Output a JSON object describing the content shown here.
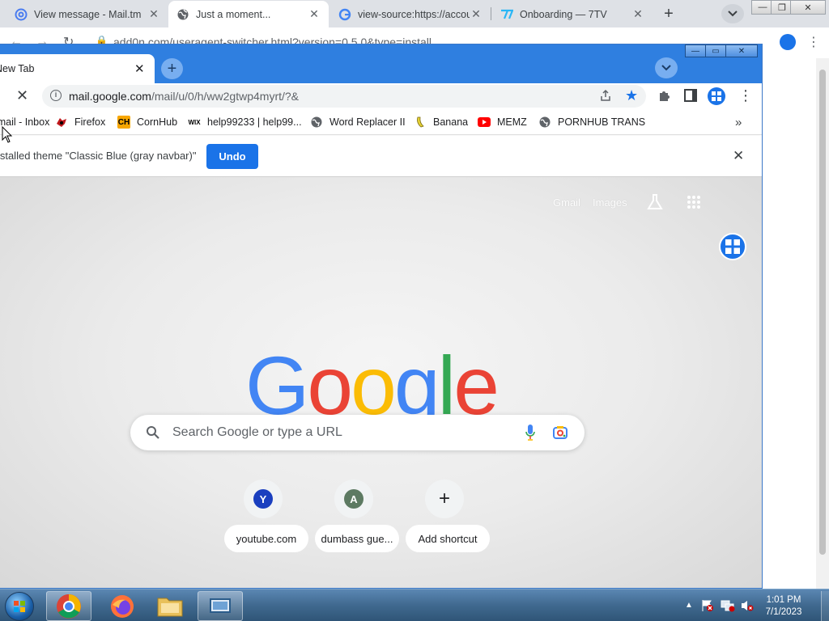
{
  "back_window": {
    "tabs": [
      {
        "title": "View message - Mail.tm",
        "icon": "at-sign-icon"
      },
      {
        "title": "Just a moment...",
        "icon": "globe-icon"
      },
      {
        "title": "view-source:https://accou",
        "icon": "google-icon"
      },
      {
        "title": "Onboarding — 7TV",
        "icon": "7tv-icon"
      }
    ],
    "url": "add0n.com/useragent-switcher.html?version=0.5.0&type=install"
  },
  "front_window": {
    "tab_title": "New Tab",
    "url_host": "mail.google.com",
    "url_path": "/mail/u/0/h/ww2gtwp4myrt/?&",
    "bookmarks": [
      {
        "label": "Gmail - Inbox",
        "icon": "gmail-icon"
      },
      {
        "label": "Firefox",
        "icon": "firefox-bookmark-icon"
      },
      {
        "label": "CornHub",
        "icon": "ch-icon"
      },
      {
        "label": "help99233 | help99...",
        "icon": "wix-icon"
      },
      {
        "label": "Word Replacer II",
        "icon": "globe-icon"
      },
      {
        "label": "Banana",
        "icon": "banana-icon"
      },
      {
        "label": "MEMZ",
        "icon": "youtube-icon"
      },
      {
        "label": "PORNHUB TRANS",
        "icon": "globe-icon"
      }
    ],
    "infobar": {
      "message": "Installed theme \"Classic Blue (gray navbar)\"",
      "undo_label": "Undo"
    }
  },
  "ntp": {
    "links": {
      "gmail": "Gmail",
      "images": "Images"
    },
    "logo_letters": [
      {
        "ch": "G",
        "color": "#4285f4"
      },
      {
        "ch": "o",
        "color": "#ea4335"
      },
      {
        "ch": "o",
        "color": "#fbbc05"
      },
      {
        "ch": "g",
        "color": "#4285f4"
      },
      {
        "ch": "l",
        "color": "#34a853"
      },
      {
        "ch": "e",
        "color": "#ea4335"
      }
    ],
    "search_placeholder": "Search Google or type a URL",
    "shortcuts": [
      {
        "letter": "Y",
        "label": "youtube.com",
        "color": "#1a3fbf"
      },
      {
        "letter": "A",
        "label": "dumbass gue...",
        "color": "#5d7a62"
      },
      {
        "letter": "+",
        "label": "Add shortcut",
        "color": ""
      }
    ]
  },
  "taskbar": {
    "apps": [
      "start-button",
      "chrome",
      "firefox",
      "file-explorer",
      "remote-desktop"
    ],
    "clock_time": "1:01 PM",
    "clock_date": "7/1/2023"
  },
  "colors": {
    "accent_blue": "#1a73e8",
    "frame_blue": "#2f7fe0"
  }
}
